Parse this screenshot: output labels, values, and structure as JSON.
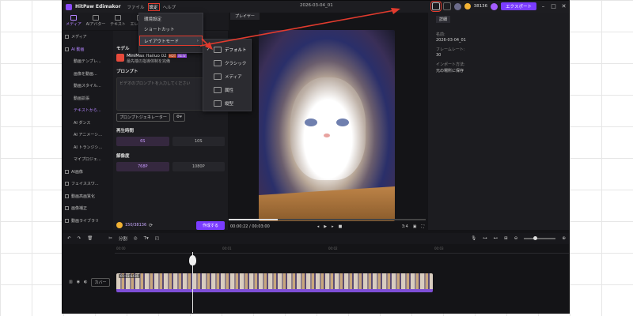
{
  "app": {
    "name": "HitPaw Edimakor",
    "doc_title": "2026-03-04_01",
    "points": "38136",
    "export_label": "エクスポート"
  },
  "menu": [
    "ファイル",
    "設定",
    "ヘルプ"
  ],
  "tooltabs": [
    "メディア",
    "AIアバター",
    "テキスト",
    "エレメント"
  ],
  "sidebar": [
    "メディア",
    "AI 動画",
    "動画テンプレ...",
    "画像を動画...",
    "動画スタイル...",
    "動画拡張",
    "テキストから...",
    "AI ダンス",
    "AI アニメーシ...",
    "AI トランジシ...",
    "マイプロジェ...",
    "AI画像",
    "フェイススワ...",
    "動画高画質化",
    "画像補正",
    "動画ライブラリ"
  ],
  "left_panel": {
    "model_label": "モデル",
    "model_name": "MiniMax Hailuo 02",
    "hot": "HOT",
    "new": "NEW",
    "model_desc": "最先端の指導体制を完備",
    "prompt_label": "プロンプト",
    "prompt_placeholder": "ビデオのプロンプトを入力してください",
    "prompt_generator": "プロンプトジェネレーター",
    "duration_label": "再生時間",
    "durations": [
      "6S",
      "10S"
    ],
    "resolution_label": "解像度",
    "resolutions": [
      "768P",
      "1080P"
    ],
    "credit": "150/38136",
    "create_label": "作成する"
  },
  "player": {
    "tab": "プレイヤー",
    "time": "00:00:22 / 00:03:00",
    "ratio": "3:4",
    "progress": 0.25
  },
  "details": {
    "tab": "詳細",
    "name_key": "名前:",
    "name_val": "2026-03-04_01",
    "fps_key": "フレームレート:",
    "fps_val": "30",
    "import_key": "インポート方法:",
    "import_val": "元の場所に保存"
  },
  "timeline": {
    "split_label": "分割",
    "cover_label": "カバー",
    "clip_label": "01:03.6416",
    "ruler": [
      "00:00",
      "00:01",
      "00:02",
      "00:03"
    ]
  },
  "settings_menu": {
    "items": [
      "環境設定",
      "ショートカット",
      "レイアウトモード"
    ]
  },
  "layout_submenu": {
    "items": [
      "デフォルト",
      "クラシック",
      "メディア",
      "属性",
      "縦型"
    ],
    "selected": "デフォルト"
  },
  "colors": {
    "accent": "#7a3cff",
    "annotation": "#e23b2e"
  }
}
